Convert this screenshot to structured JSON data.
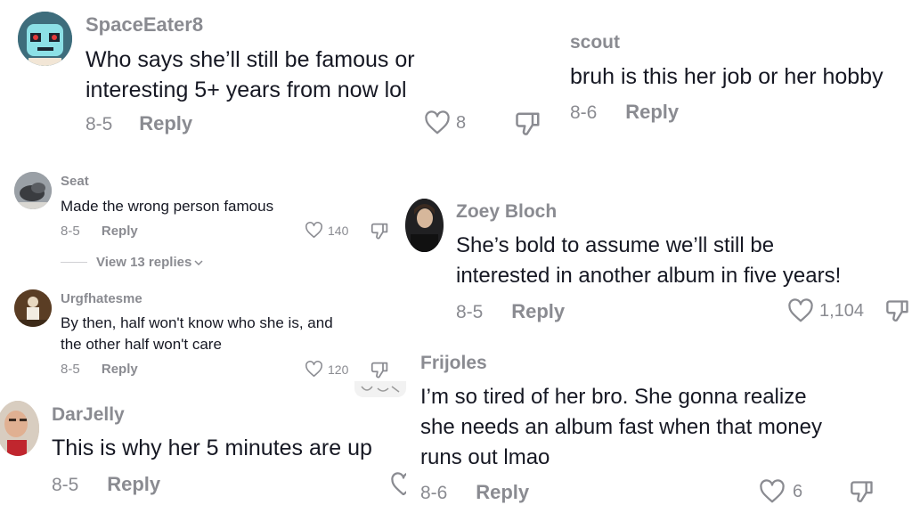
{
  "comments": [
    {
      "user": "SpaceEater8",
      "text": "Who says she’ll still be famous or\ninteresting 5+ years from now lol",
      "date": "8-5",
      "reply": "Reply",
      "likes": "8"
    },
    {
      "user": "scout",
      "text": "bruh is this her job or her hobby",
      "date": "8-6",
      "reply": "Reply"
    },
    {
      "user": "Seat",
      "text": "Made the wrong person famous",
      "date": "8-5",
      "reply": "Reply",
      "likes": "140",
      "view_replies": "View 13 replies"
    },
    {
      "user": "Zoey Bloch",
      "text": "She’s bold to assume we’ll still be\ninterested in another album in five years!",
      "date": "8-5",
      "reply": "Reply",
      "likes": "1,104"
    },
    {
      "user": "Urgfhatesme",
      "text": "By then, half won't know who she is, and\nthe other half won't care",
      "date": "8-5",
      "reply": "Reply",
      "likes": "120"
    },
    {
      "user": "Frijoles",
      "text": "I’m so tired of her bro. She gonna realize\nshe needs an album fast when that money\nruns out lmao",
      "date": "8-6",
      "reply": "Reply",
      "likes": "6"
    },
    {
      "user": "DarJelly",
      "text": "This is why her 5 minutes are up",
      "date": "8-5",
      "reply": "Reply"
    }
  ],
  "colors": {
    "text": "#161823",
    "muted": "#8a8b91"
  },
  "icons": {
    "like": "heart-outline-icon",
    "dislike": "thumbs-down-icon",
    "chevron": "chevron-down-icon"
  }
}
